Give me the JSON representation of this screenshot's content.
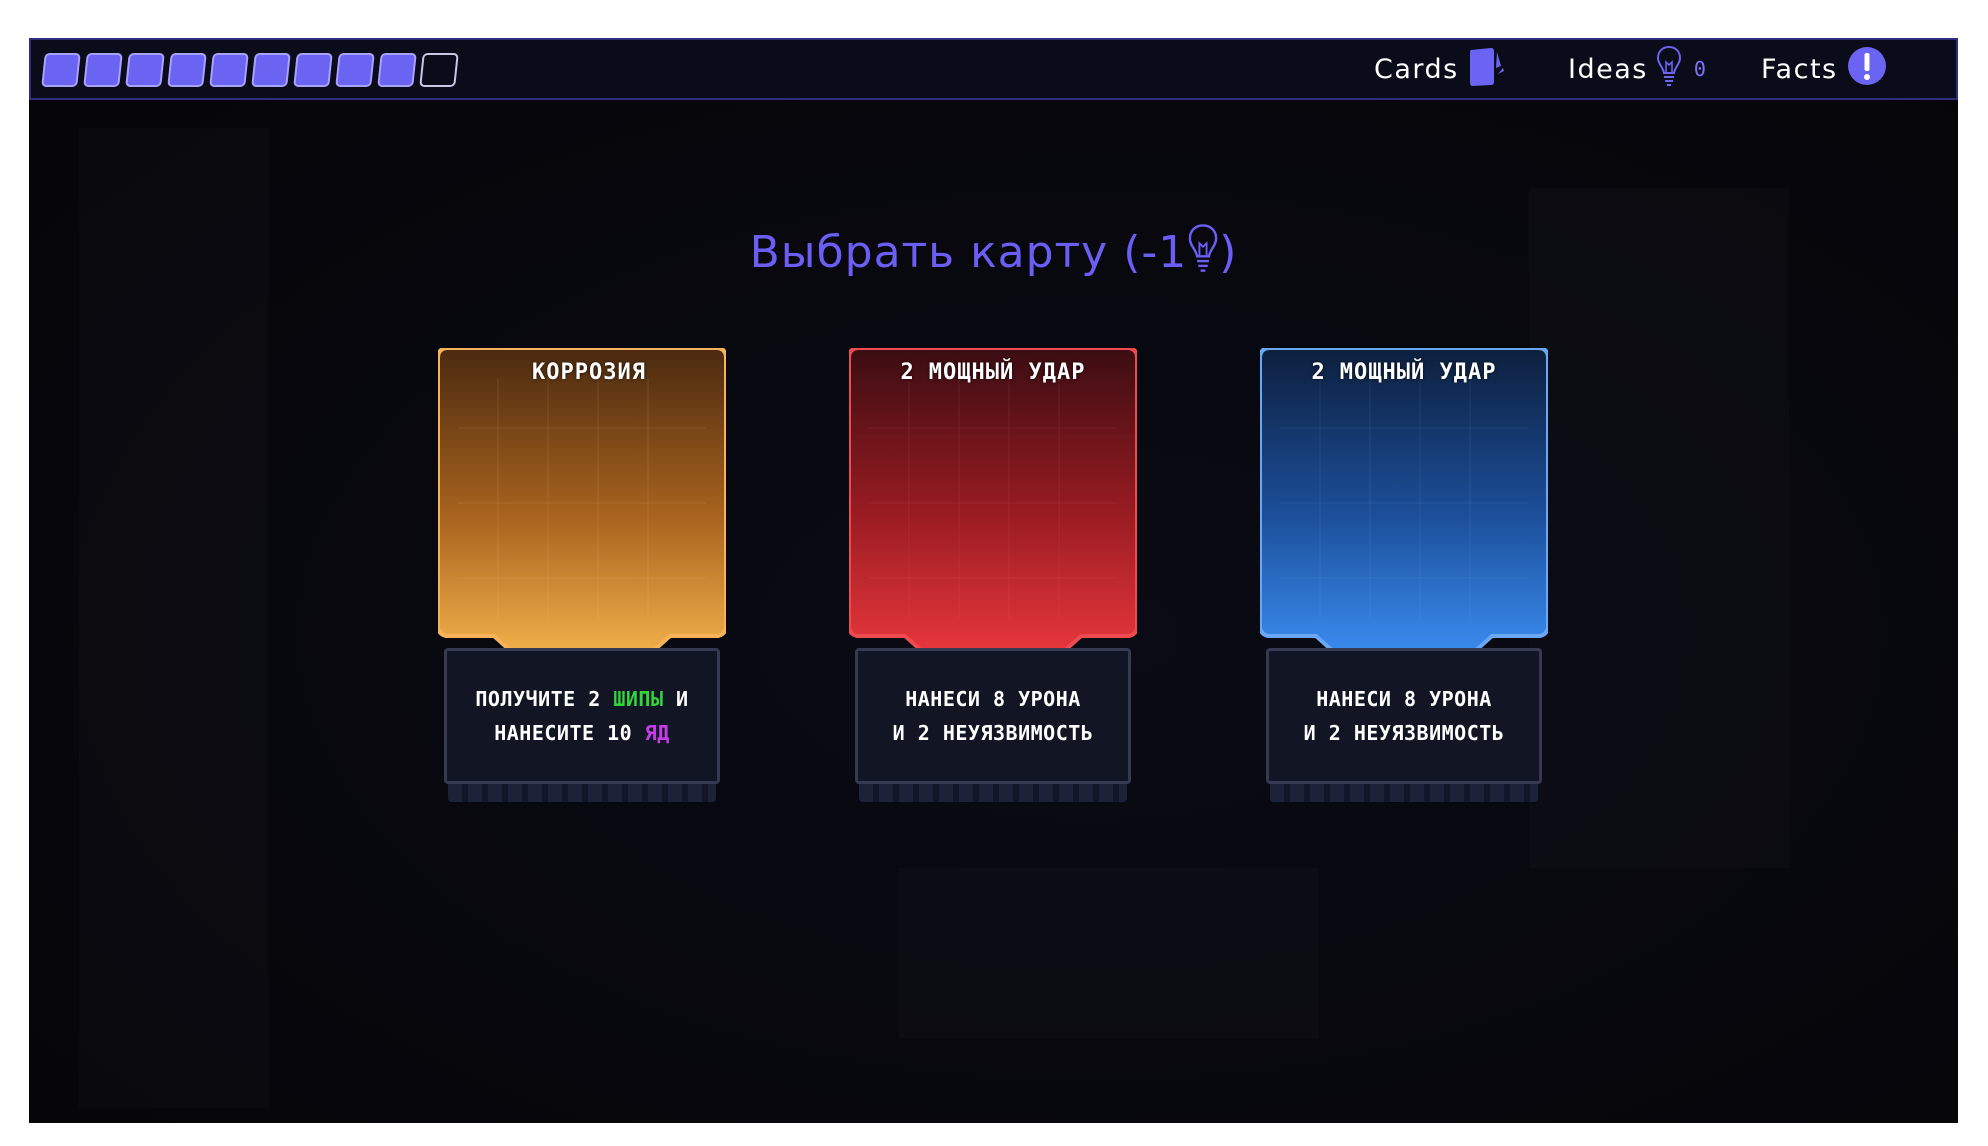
{
  "topbar": {
    "energy": {
      "filled": 9,
      "total": 10
    },
    "nav": {
      "cards_label": "Cards",
      "ideas_label": "Ideas",
      "ideas_count": "0",
      "facts_label": "Facts"
    }
  },
  "title": {
    "text": "Выбрать карту (-1",
    "close": ")"
  },
  "cards": [
    {
      "cost": "",
      "name": "КОРРОЗИЯ",
      "line1_a": "ПОЛУЧИТЕ 2 ",
      "line1_kw": "ШИПЫ",
      "line1_b": " И",
      "line2_a": "НАНЕСИТЕ 10 ",
      "line2_kw": "ЯД",
      "line2_b": ""
    },
    {
      "cost": "2",
      "name": "МОЩНЫЙ УДАР",
      "line1": "НАНЕСИ 8 УРОНА",
      "line2": "И 2 НЕУЯЗВИМОСТЬ"
    },
    {
      "cost": "2",
      "name": "МОЩНЫЙ УДАР",
      "line1": "НАНЕСИ 8 УРОНА",
      "line2": "И 2 НЕУЯЗВИМОСТЬ"
    }
  ],
  "colors": {
    "accent": "#6a5ef5",
    "card_orange": "#f0a844",
    "card_red": "#e3383c",
    "card_blue": "#3a8cf0",
    "keyword_green": "#33d63a",
    "keyword_purple": "#c63ce8"
  },
  "icons": {
    "cards": "cards-icon",
    "ideas": "lightbulb-icon",
    "facts": "exclamation-icon"
  }
}
